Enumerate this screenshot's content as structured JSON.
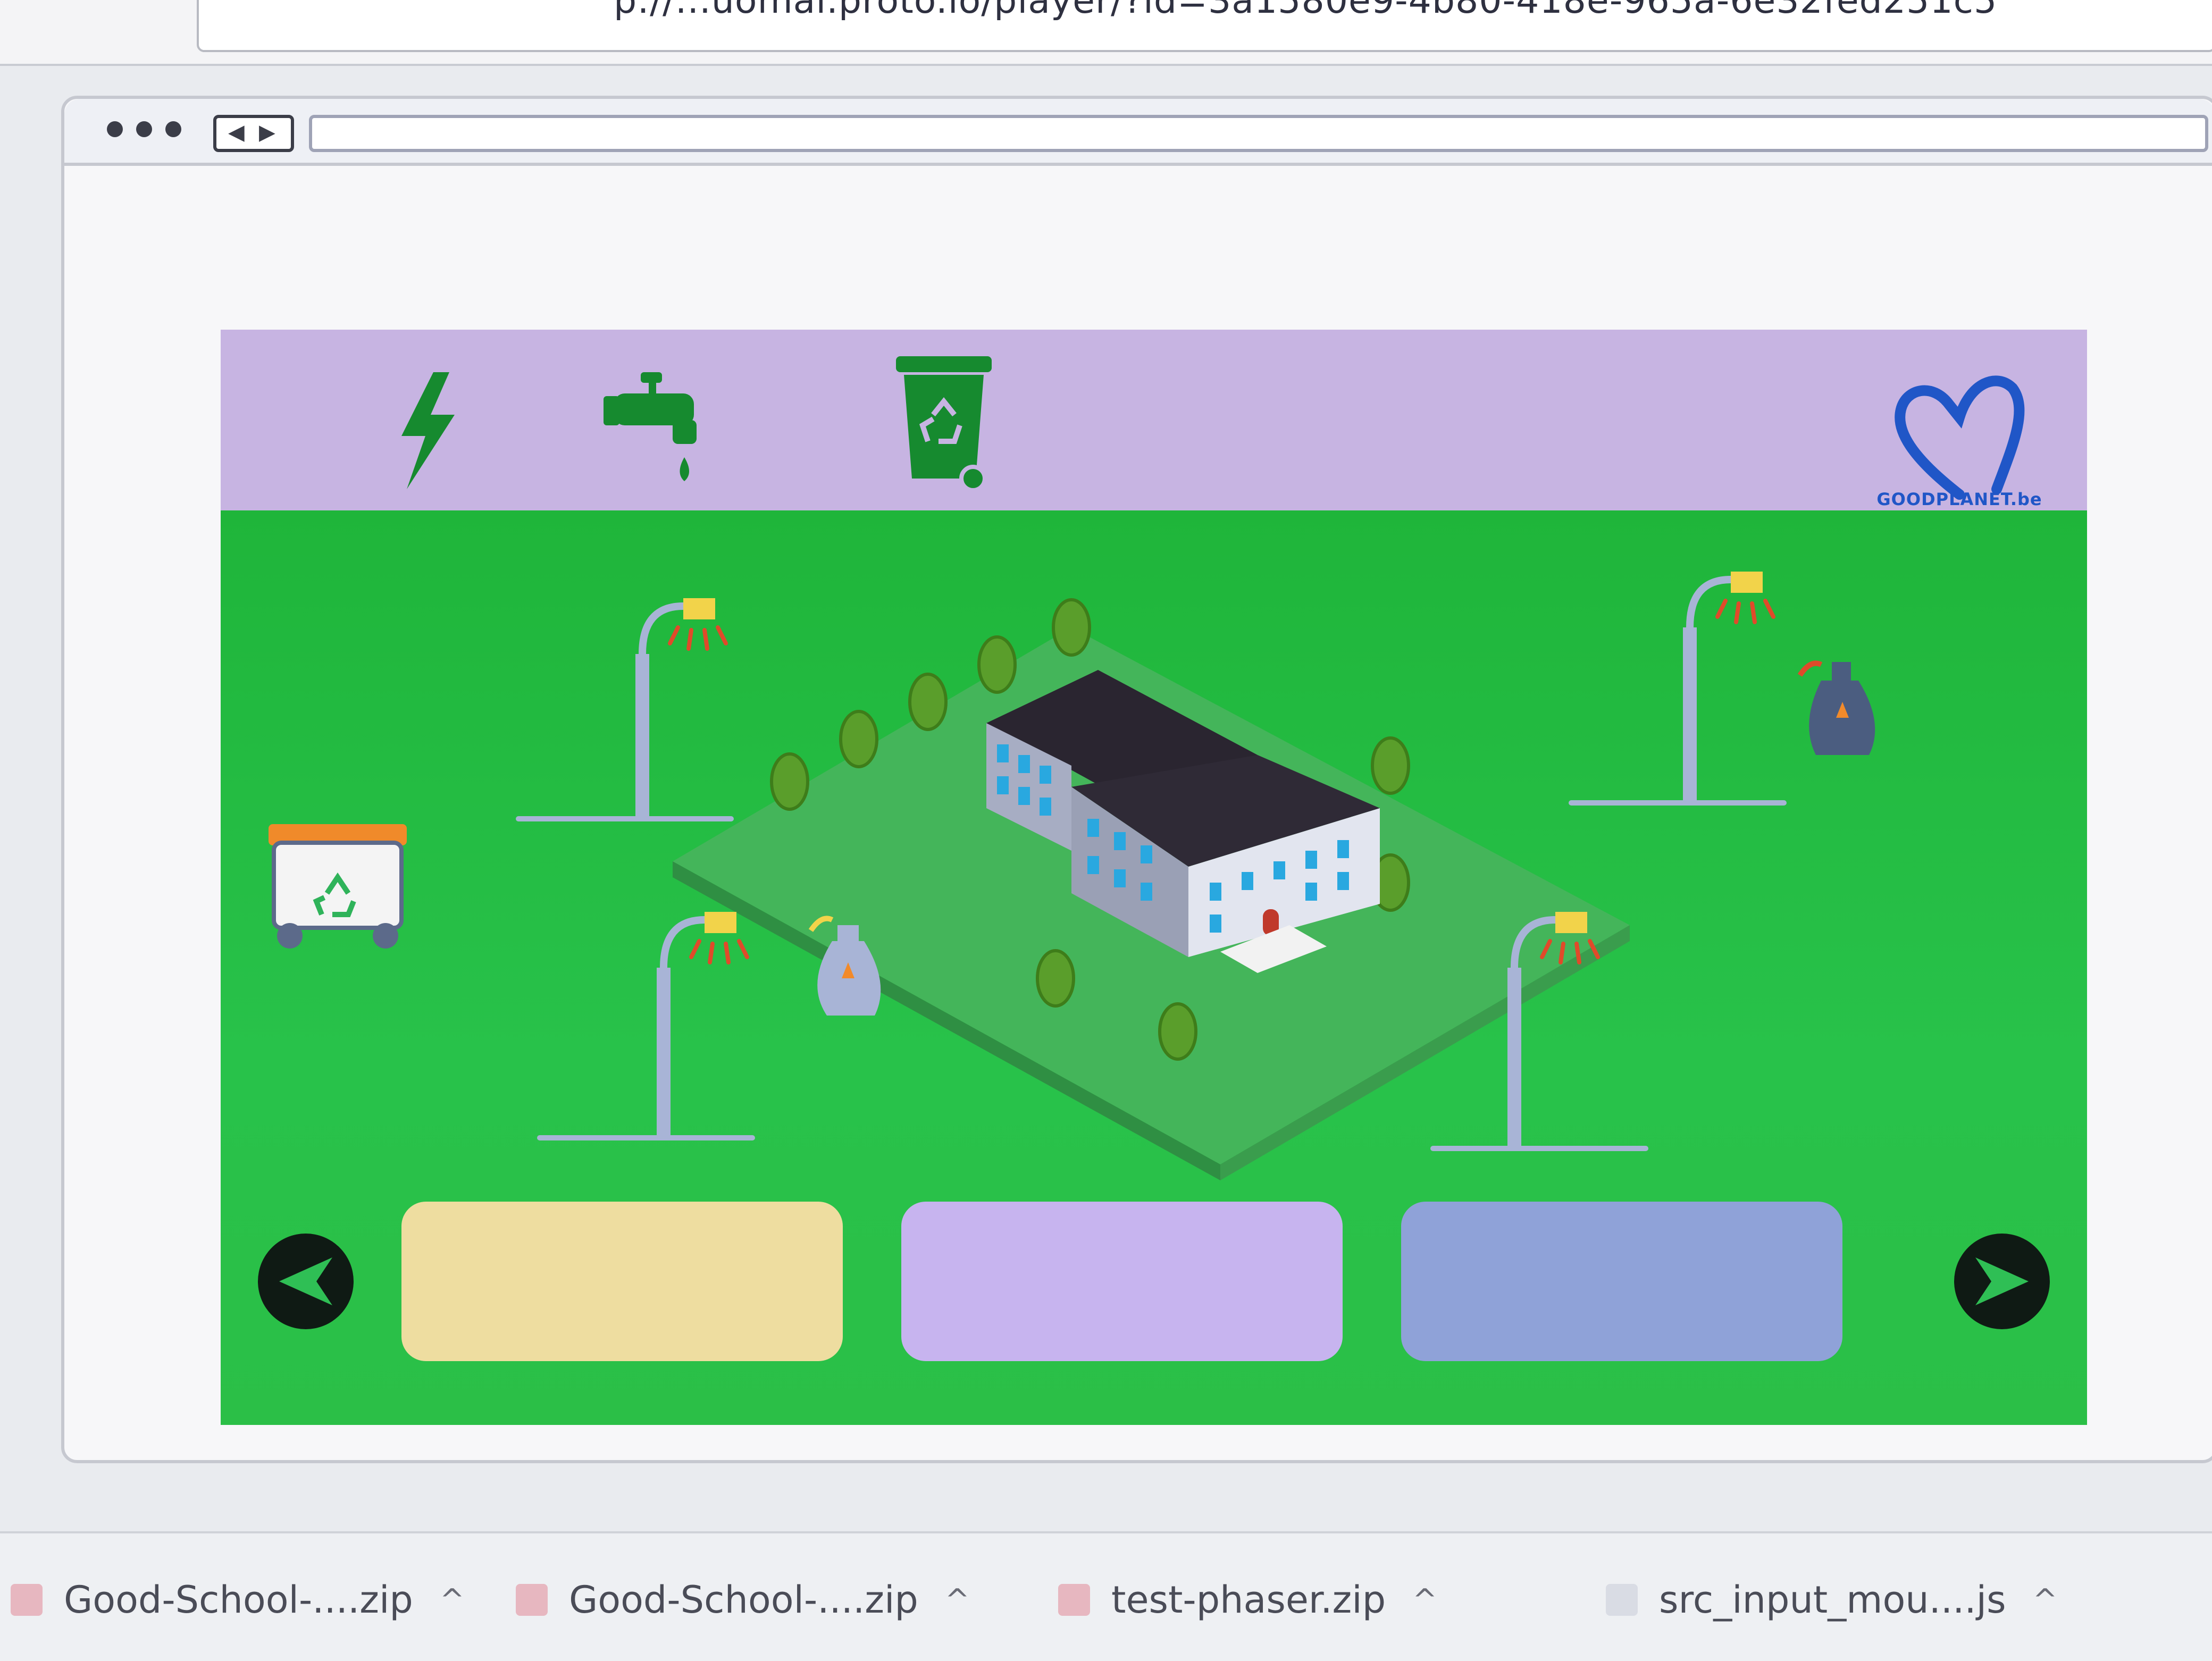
{
  "browser": {
    "url": "p://...uomal.proto.io/player/?id=3a1580e9-4b80-418e-965a-6e32fed251c5"
  },
  "game": {
    "top_bar_icons": [
      "lightning-icon",
      "water-tap-icon",
      "recycle-bin-icon"
    ],
    "logo": {
      "name": "heart-logo",
      "text": "GOODPLANET.be"
    },
    "colors": {
      "top_bar": "#c7b4e2",
      "field": "#1fb53a",
      "panel_yellow": "#eedda0",
      "panel_lilac": "#c7b4ef",
      "panel_blue": "#8fa2d8",
      "nav_button": "#0f1a14"
    },
    "nav": {
      "prev_icon": "arrow-left-icon",
      "next_icon": "arrow-right-icon"
    }
  },
  "downloads": [
    {
      "name": "Good-School-....zip"
    },
    {
      "name": "Good-School-....zip"
    },
    {
      "name": "test-phaser.zip"
    },
    {
      "name": "src_input_mou....js"
    }
  ]
}
